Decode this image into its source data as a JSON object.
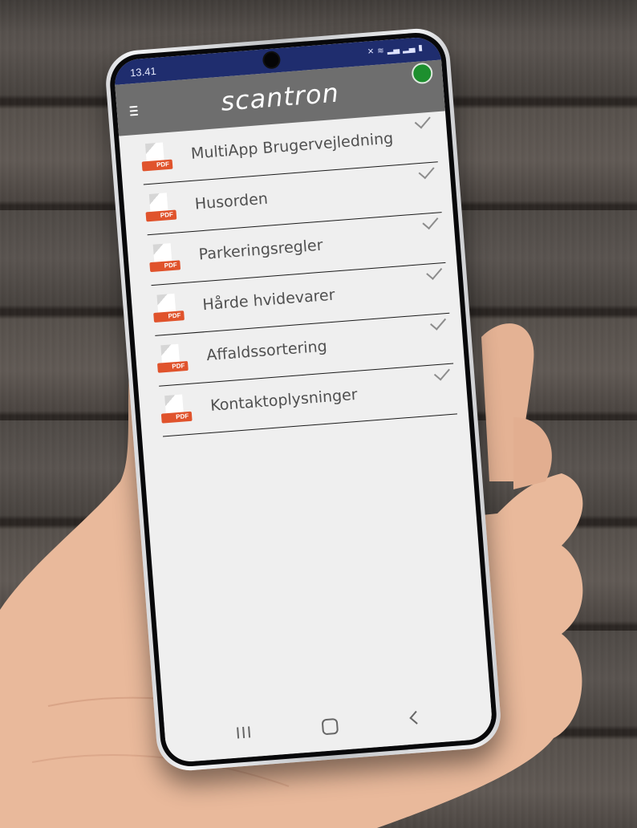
{
  "status_bar": {
    "time": "13.41",
    "icons": [
      "mute-icon",
      "wifi-icon",
      "signal-icon",
      "signal-icon",
      "battery-icon"
    ]
  },
  "app_bar": {
    "brand": "scantron",
    "menu_icon": "hamburger-menu-icon",
    "status_indicator_color": "#1d8f2e"
  },
  "documents": [
    {
      "title": "MultiApp Brugervejledning",
      "badge": "PDF"
    },
    {
      "title": "Husorden",
      "badge": "PDF"
    },
    {
      "title": "Parkeringsregler",
      "badge": "PDF"
    },
    {
      "title": "Hårde hvidevarer",
      "badge": "PDF"
    },
    {
      "title": "Affaldssortering",
      "badge": "PDF"
    },
    {
      "title": "Kontaktoplysninger",
      "badge": "PDF"
    }
  ],
  "nav_bar": {
    "icons": [
      "recent-apps-icon",
      "home-icon",
      "back-icon"
    ]
  },
  "colors": {
    "status_bar": "#1f2d6e",
    "app_bar": "#6e6e6e",
    "pdf_badge": "#e0532c",
    "screen_bg": "#efefef"
  }
}
